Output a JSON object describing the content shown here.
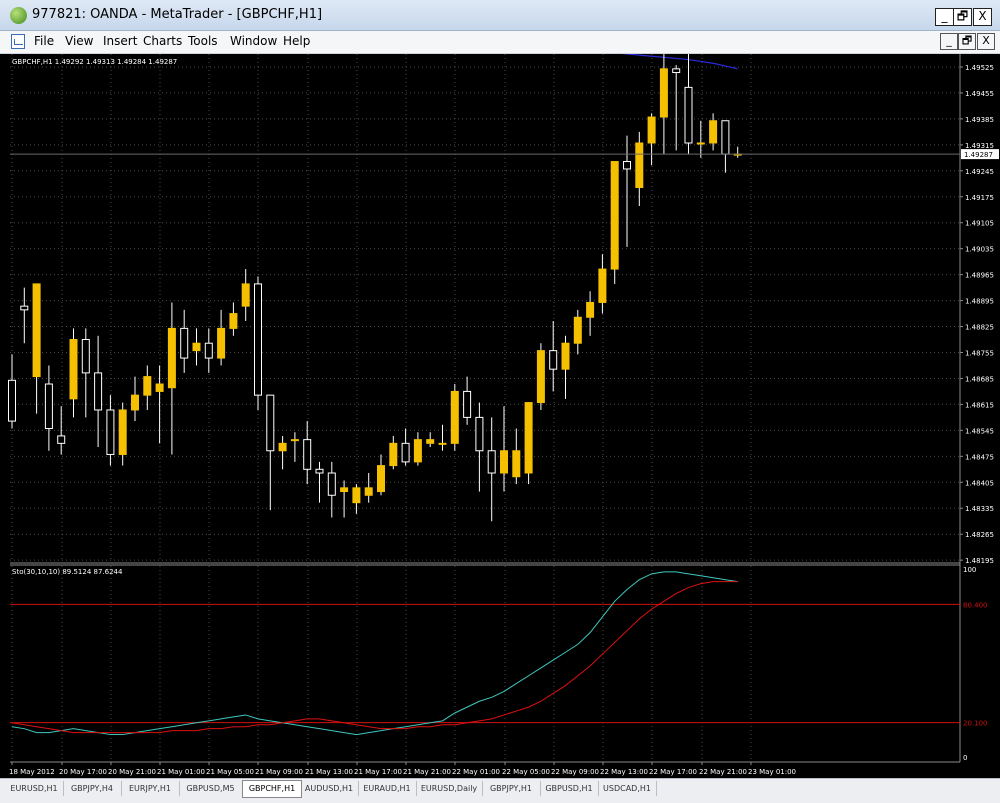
{
  "window": {
    "title": "977821: OANDA - MetaTrader - [GBPCHF,H1]",
    "minimize_label": "_",
    "restore_label": "🗗",
    "close_label": "X"
  },
  "menu": {
    "items": [
      "File",
      "View",
      "Insert",
      "Charts",
      "Tools",
      "Window",
      "Help"
    ],
    "mdi_min": "_",
    "mdi_restore": "🗗",
    "mdi_close": "X"
  },
  "chart": {
    "info_label": "GBPCHF,H1  1.49292 1.49313 1.49284 1.49287",
    "current_price_label": "1.49287",
    "colors": {
      "bg": "#000000",
      "bull": "#f5c000",
      "bear": "#ffffff",
      "grid": "#4a4a4a",
      "ma": "#2a2adb",
      "stoch_main": "#3fc7bf",
      "stoch_signal": "#e01010",
      "level": "#d01010"
    }
  },
  "stoch": {
    "label": "Sto(30,10,10) 89.5124 87.6244",
    "level_high_label": "80.400",
    "level_low_label": "20.100",
    "scale_top": "100",
    "scale_bottom": "0"
  },
  "chart_data": {
    "type": "candlestick",
    "symbol": "GBPCHF",
    "timeframe": "H1",
    "price_axis": [
      "1.49525",
      "1.49455",
      "1.49385",
      "1.49315",
      "1.49245",
      "1.49175",
      "1.49105",
      "1.49035",
      "1.48965",
      "1.48895",
      "1.48825",
      "1.48755",
      "1.48685",
      "1.48615",
      "1.48545",
      "1.48475",
      "1.48405",
      "1.48335",
      "1.48265",
      "1.48195"
    ],
    "ylim": [
      1.4819,
      1.4956
    ],
    "time_axis": [
      "18 May 2012",
      "20 May 17:00",
      "20 May 21:00",
      "21 May 01:00",
      "21 May 05:00",
      "21 May 09:00",
      "21 May 13:00",
      "21 May 17:00",
      "21 May 21:00",
      "22 May 01:00",
      "22 May 05:00",
      "22 May 09:00",
      "22 May 13:00",
      "22 May 17:00",
      "22 May 21:00",
      "23 May 01:00"
    ],
    "candles": [
      [
        1.4868,
        1.4875,
        1.4855,
        1.4857
      ],
      [
        1.4888,
        1.4893,
        1.4878,
        1.4887
      ],
      [
        1.4869,
        1.4894,
        1.4859,
        1.4894
      ],
      [
        1.4867,
        1.4872,
        1.4849,
        1.4855
      ],
      [
        1.4853,
        1.4861,
        1.4848,
        1.4851
      ],
      [
        1.4863,
        1.4882,
        1.4858,
        1.4879
      ],
      [
        1.4879,
        1.4882,
        1.4858,
        1.487
      ],
      [
        1.487,
        1.488,
        1.485,
        1.486
      ],
      [
        1.486,
        1.4864,
        1.4845,
        1.4848
      ],
      [
        1.4848,
        1.4862,
        1.4845,
        1.486
      ],
      [
        1.486,
        1.4869,
        1.4857,
        1.4864
      ],
      [
        1.4864,
        1.4872,
        1.486,
        1.4869
      ],
      [
        1.4865,
        1.4872,
        1.4851,
        1.4867
      ],
      [
        1.4866,
        1.4889,
        1.4848,
        1.4882
      ],
      [
        1.4882,
        1.4887,
        1.487,
        1.4874
      ],
      [
        1.4876,
        1.4882,
        1.4872,
        1.4878
      ],
      [
        1.4878,
        1.4882,
        1.487,
        1.4874
      ],
      [
        1.4874,
        1.4887,
        1.4872,
        1.4882
      ],
      [
        1.4882,
        1.4889,
        1.488,
        1.4886
      ],
      [
        1.4888,
        1.4898,
        1.4884,
        1.4894
      ],
      [
        1.4894,
        1.4896,
        1.486,
        1.4864
      ],
      [
        1.4864,
        1.4864,
        1.4833,
        1.4849
      ],
      [
        1.4849,
        1.4853,
        1.4844,
        1.4851
      ],
      [
        1.4852,
        1.4854,
        1.4846,
        1.4852
      ],
      [
        1.4852,
        1.4857,
        1.484,
        1.4844
      ],
      [
        1.4844,
        1.4846,
        1.4835,
        1.4843
      ],
      [
        1.4843,
        1.4846,
        1.4831,
        1.4837
      ],
      [
        1.4838,
        1.4841,
        1.4831,
        1.4839
      ],
      [
        1.4835,
        1.484,
        1.4832,
        1.4839
      ],
      [
        1.4837,
        1.4843,
        1.4835,
        1.4839
      ],
      [
        1.4838,
        1.4848,
        1.4837,
        1.4845
      ],
      [
        1.4845,
        1.4853,
        1.4844,
        1.4851
      ],
      [
        1.4851,
        1.4855,
        1.4845,
        1.4846
      ],
      [
        1.4846,
        1.4854,
        1.4845,
        1.4852
      ],
      [
        1.4851,
        1.4854,
        1.485,
        1.4852
      ],
      [
        1.4851,
        1.4856,
        1.4849,
        1.4851
      ],
      [
        1.4851,
        1.4867,
        1.4849,
        1.4865
      ],
      [
        1.4865,
        1.4869,
        1.4856,
        1.4858
      ],
      [
        1.4858,
        1.4862,
        1.4838,
        1.4849
      ],
      [
        1.4849,
        1.4858,
        1.483,
        1.4843
      ],
      [
        1.4843,
        1.4861,
        1.4838,
        1.4849
      ],
      [
        1.4842,
        1.4855,
        1.484,
        1.4849
      ],
      [
        1.4843,
        1.4862,
        1.484,
        1.4862
      ],
      [
        1.4862,
        1.4878,
        1.486,
        1.4876
      ],
      [
        1.4876,
        1.4884,
        1.4865,
        1.4871
      ],
      [
        1.4871,
        1.488,
        1.4863,
        1.4878
      ],
      [
        1.4878,
        1.4887,
        1.4875,
        1.4885
      ],
      [
        1.4885,
        1.4892,
        1.488,
        1.4889
      ],
      [
        1.4889,
        1.4902,
        1.4886,
        1.4898
      ],
      [
        1.4898,
        1.4912,
        1.4894,
        1.4927
      ],
      [
        1.4927,
        1.4934,
        1.4904,
        1.4925
      ],
      [
        1.492,
        1.4935,
        1.4915,
        1.4932
      ],
      [
        1.4932,
        1.494,
        1.4926,
        1.4939
      ],
      [
        1.4939,
        1.4956,
        1.4929,
        1.4952
      ],
      [
        1.4952,
        1.4953,
        1.493,
        1.4951
      ],
      [
        1.4947,
        1.4956,
        1.4929,
        1.4932
      ],
      [
        1.4932,
        1.4938,
        1.4928,
        1.4932
      ],
      [
        1.4932,
        1.494,
        1.493,
        1.4938
      ],
      [
        1.4938,
        1.4938,
        1.4924,
        1.4929
      ],
      [
        1.4929,
        1.4931,
        1.4928,
        1.4929
      ]
    ],
    "ma_line": [
      [
        45,
        1.4958
      ],
      [
        50,
        1.4956
      ],
      [
        55,
        1.49545
      ],
      [
        57,
        1.49535
      ],
      [
        59,
        1.4952
      ]
    ],
    "stochastic": {
      "levels": [
        80.4,
        20.1
      ],
      "main": [
        18,
        17,
        15,
        15,
        16,
        17,
        16,
        15,
        14,
        14,
        15,
        16,
        17,
        18,
        19,
        20,
        21,
        22,
        23,
        24,
        22,
        21,
        20,
        19,
        18,
        17,
        16,
        15,
        14,
        15,
        16,
        17,
        18,
        19,
        20,
        21,
        25,
        28,
        31,
        33,
        36,
        40,
        44,
        48,
        52,
        56,
        60,
        66,
        74,
        82,
        88,
        93,
        96,
        97,
        97,
        96,
        95,
        94,
        93,
        92
      ],
      "signal": [
        20,
        19,
        18,
        17,
        16,
        15,
        15,
        15,
        15,
        15,
        15,
        15,
        15,
        16,
        16,
        16,
        17,
        17,
        18,
        18,
        19,
        19,
        20,
        21,
        22,
        22,
        21,
        20,
        19,
        18,
        17,
        17,
        17,
        18,
        18,
        19,
        19,
        20,
        21,
        22,
        24,
        26,
        28,
        31,
        35,
        39,
        44,
        49,
        55,
        61,
        67,
        73,
        78,
        82,
        86,
        89,
        91,
        92,
        92,
        92
      ]
    }
  },
  "tabs": [
    {
      "label": "EURUSD,H1",
      "active": false
    },
    {
      "label": "GBPJPY,H4",
      "active": false
    },
    {
      "label": "EURJPY,H1",
      "active": false
    },
    {
      "label": "GBPUSD,M5",
      "active": false
    },
    {
      "label": "GBPCHF,H1",
      "active": true
    },
    {
      "label": "AUDUSD,H1",
      "active": false
    },
    {
      "label": "EURAUD,H1",
      "active": false
    },
    {
      "label": "EURUSD,Daily",
      "active": false
    },
    {
      "label": "GBPJPY,H1",
      "active": false
    },
    {
      "label": "GBPUSD,H1",
      "active": false
    },
    {
      "label": "USDCAD,H1",
      "active": false
    }
  ]
}
